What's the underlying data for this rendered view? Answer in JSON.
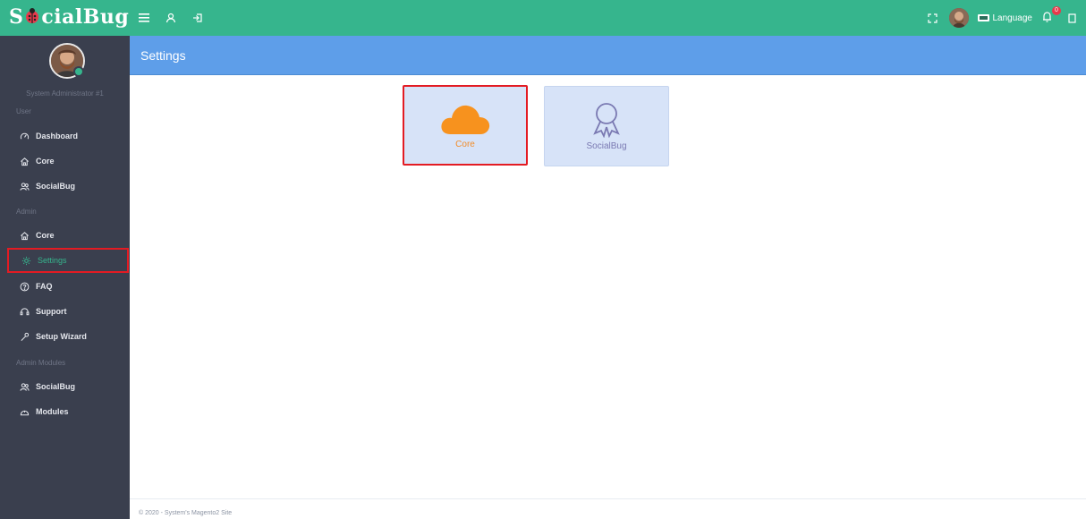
{
  "app": {
    "brand": "SocialBug",
    "accent_color": "#36b58d"
  },
  "topbar": {
    "left_icons": [
      "menu-icon",
      "user-icon",
      "logout-icon"
    ],
    "language_label": "Language",
    "notification_count": "0"
  },
  "sidebar": {
    "user_name": "System Administrator #1",
    "sections": [
      {
        "title": "User",
        "items": [
          {
            "label": "Dashboard",
            "icon": "dashboard-icon"
          },
          {
            "label": "Core",
            "icon": "home-icon"
          },
          {
            "label": "SocialBug",
            "icon": "users-icon"
          }
        ]
      },
      {
        "title": "Admin",
        "items": [
          {
            "label": "Core",
            "icon": "home-icon"
          },
          {
            "label": "Settings",
            "icon": "gear-icon",
            "active": true
          },
          {
            "label": "FAQ",
            "icon": "question-icon"
          },
          {
            "label": "Support",
            "icon": "support-icon"
          },
          {
            "label": "Setup Wizard",
            "icon": "wand-icon"
          }
        ]
      },
      {
        "title": "Admin Modules",
        "items": [
          {
            "label": "SocialBug",
            "icon": "users-icon"
          },
          {
            "label": "Modules",
            "icon": "modules-icon"
          }
        ]
      }
    ]
  },
  "page": {
    "title": "Settings",
    "cards": [
      {
        "label": "Core",
        "icon": "cloud-icon",
        "color": "#f28c28"
      },
      {
        "label": "SocialBug",
        "icon": "award-icon",
        "color": "#7a79b2"
      }
    ]
  },
  "footer": {
    "text": "© 2020 - System's Magento2 Site"
  }
}
